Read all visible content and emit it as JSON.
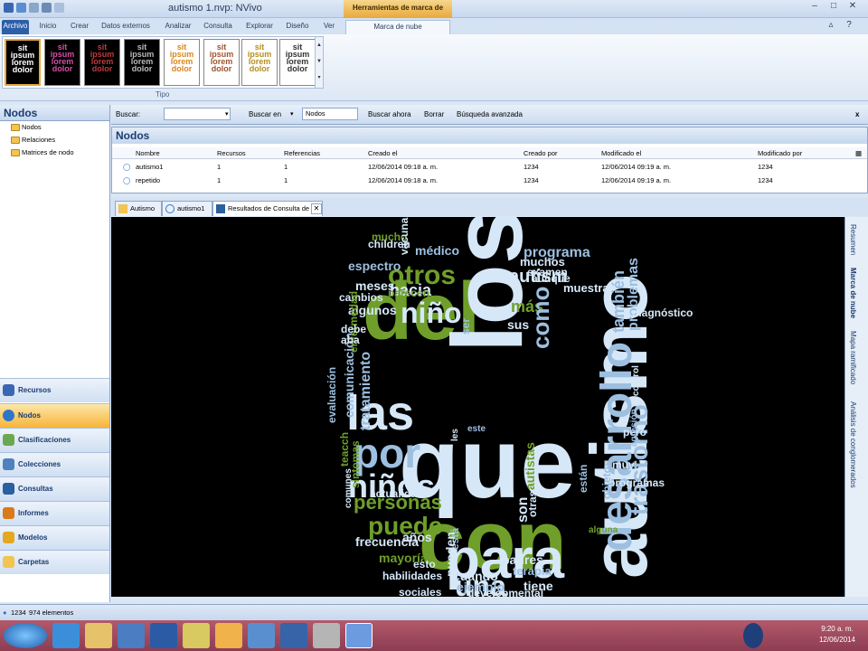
{
  "window": {
    "title": "autismo 1.nvp: NVivo",
    "context_tab": "Herramientas de marca de nube"
  },
  "ribbon": {
    "tabs": [
      "Archivo",
      "Inicio",
      "Crear",
      "Datos externos",
      "Analizar",
      "Consulta",
      "Explorar",
      "Diseño",
      "Ver",
      "Marca de nube"
    ],
    "group_label": "Tipo",
    "thumb_words": [
      "sit",
      "ipsum",
      "lorem",
      "dolor"
    ]
  },
  "left": {
    "header": "Nodos",
    "tree": [
      "Nodos",
      "Relaciones",
      "Matrices de nodo"
    ],
    "nav": [
      "Recursos",
      "Nodos",
      "Clasificaciones",
      "Colecciones",
      "Consultas",
      "Informes",
      "Modelos",
      "Carpetas"
    ]
  },
  "search": {
    "label": "Buscar:",
    "value": "",
    "in_label": "Buscar en",
    "scope": "Nodos",
    "go": "Buscar ahora",
    "clear": "Borrar",
    "advanced": "Búsqueda avanzada",
    "close": "x"
  },
  "list": {
    "header": "Nodos",
    "columns": [
      "Nombre",
      "Recursos",
      "Referencias",
      "Creado el",
      "Creado por",
      "Modificado el",
      "Modificado por"
    ],
    "rows": [
      {
        "name": "autismo1",
        "sources": "1",
        "refs": "1",
        "created": "12/06/2014 09:18 a. m.",
        "created_by": "1234",
        "modified": "12/06/2014 09:19 a. m.",
        "modified_by": "1234"
      },
      {
        "name": "repetido",
        "sources": "1",
        "refs": "1",
        "created": "12/06/2014 09:18 a. m.",
        "created_by": "1234",
        "modified": "12/06/2014 09:19 a. m.",
        "modified_by": "1234"
      }
    ]
  },
  "doc_tabs": [
    "Autismo",
    "autismo1",
    "Resultados de Consulta de fre"
  ],
  "side_tabs": [
    "Resumen",
    "Marca de nube",
    "Mapa ramificado",
    "Análisis de conglomerados"
  ],
  "cloud": {
    "colors": {
      "green": "#6f9f2a",
      "light": "#d6e8f8",
      "blue": "#9dbfe0",
      "grey": "#c9c9c9"
    },
    "words": [
      {
        "t": "del",
        "c": "green"
      },
      {
        "t": "los",
        "c": "light"
      },
      {
        "t": "que",
        "c": "light"
      },
      {
        "t": "con",
        "c": "green"
      },
      {
        "t": "autismo",
        "c": "light"
      },
      {
        "t": "las",
        "c": "light"
      },
      {
        "t": "por",
        "c": "blue"
      },
      {
        "t": "para",
        "c": "light"
      },
      {
        "t": "niños",
        "c": "light"
      },
      {
        "t": "niño",
        "c": "light"
      },
      {
        "t": "otros",
        "c": "green"
      },
      {
        "t": "autism",
        "c": "light"
      },
      {
        "t": "desarrollo",
        "c": "blue"
      },
      {
        "t": "trastorno",
        "c": "blue"
      },
      {
        "t": "puede",
        "c": "green"
      },
      {
        "t": "personas",
        "c": "green"
      },
      {
        "t": "una",
        "c": "light"
      },
      {
        "t": "hacia",
        "c": "light"
      },
      {
        "t": "espectro",
        "c": "blue"
      },
      {
        "t": "meses",
        "c": "light"
      },
      {
        "t": "cambios",
        "c": "light"
      },
      {
        "t": "algunos",
        "c": "light"
      },
      {
        "t": "más",
        "c": "green"
      },
      {
        "t": "sus",
        "c": "light"
      },
      {
        "t": "como",
        "c": "blue"
      },
      {
        "t": "programa",
        "c": "blue"
      },
      {
        "t": "médico",
        "c": "blue"
      },
      {
        "t": "muchos",
        "c": "light"
      },
      {
        "t": "examen",
        "c": "light"
      },
      {
        "t": "muestra",
        "c": "light"
      },
      {
        "t": "también",
        "c": "blue"
      },
      {
        "t": "problemas",
        "c": "blue"
      },
      {
        "t": "diagnóstico",
        "c": "light"
      },
      {
        "t": "frecuencia",
        "c": "light"
      },
      {
        "t": "años",
        "c": "light"
      },
      {
        "t": "mayoría",
        "c": "green"
      },
      {
        "t": "padres",
        "c": "light"
      },
      {
        "t": "terapia",
        "c": "blue"
      },
      {
        "t": "cuando",
        "c": "light"
      },
      {
        "t": "tiene",
        "c": "light"
      },
      {
        "t": "ejemplo",
        "c": "blue"
      },
      {
        "t": "habilidades",
        "c": "light"
      },
      {
        "t": "sociales",
        "c": "light"
      },
      {
        "t": "developmental",
        "c": "light"
      },
      {
        "t": "comunicación",
        "c": "blue"
      },
      {
        "t": "evaluación",
        "c": "blue"
      },
      {
        "t": "tratamiento",
        "c": "blue"
      },
      {
        "t": "enfermedad",
        "c": "green"
      },
      {
        "t": "debe",
        "c": "light"
      },
      {
        "t": "aba",
        "c": "light"
      },
      {
        "t": "parecen",
        "c": "green"
      },
      {
        "t": "ser",
        "c": "blue"
      },
      {
        "t": "children",
        "c": "light"
      },
      {
        "t": "mucho",
        "c": "green"
      },
      {
        "t": "vacuna",
        "c": "light"
      },
      {
        "t": "aunque",
        "c": "light"
      },
      {
        "t": "control",
        "c": "light"
      },
      {
        "t": "pero",
        "c": "light"
      },
      {
        "t": "agresión",
        "c": "blue"
      },
      {
        "t": "muy",
        "c": "light"
      },
      {
        "t": "programas",
        "c": "light"
      },
      {
        "t": "objetos",
        "c": "blue"
      },
      {
        "t": "autistas",
        "c": "green"
      },
      {
        "t": "están",
        "c": "blue"
      },
      {
        "t": "actualidad",
        "c": "light"
      },
      {
        "t": "síntomas",
        "c": "green"
      },
      {
        "t": "teacch",
        "c": "green"
      },
      {
        "t": "esto",
        "c": "light"
      },
      {
        "t": "está",
        "c": "blue"
      },
      {
        "t": "pueden",
        "c": "light"
      },
      {
        "t": "alguna",
        "c": "green"
      },
      {
        "t": "son",
        "c": "light"
      },
      {
        "t": "este",
        "c": "blue"
      },
      {
        "t": "les",
        "c": "light"
      },
      {
        "t": "comunes",
        "c": "light"
      },
      {
        "t": "otras",
        "c": "light"
      }
    ]
  },
  "status": {
    "user": "1234",
    "count": "974 elementos"
  },
  "clock": {
    "time": "9:20 a. m.",
    "date": "12/06/2014"
  }
}
